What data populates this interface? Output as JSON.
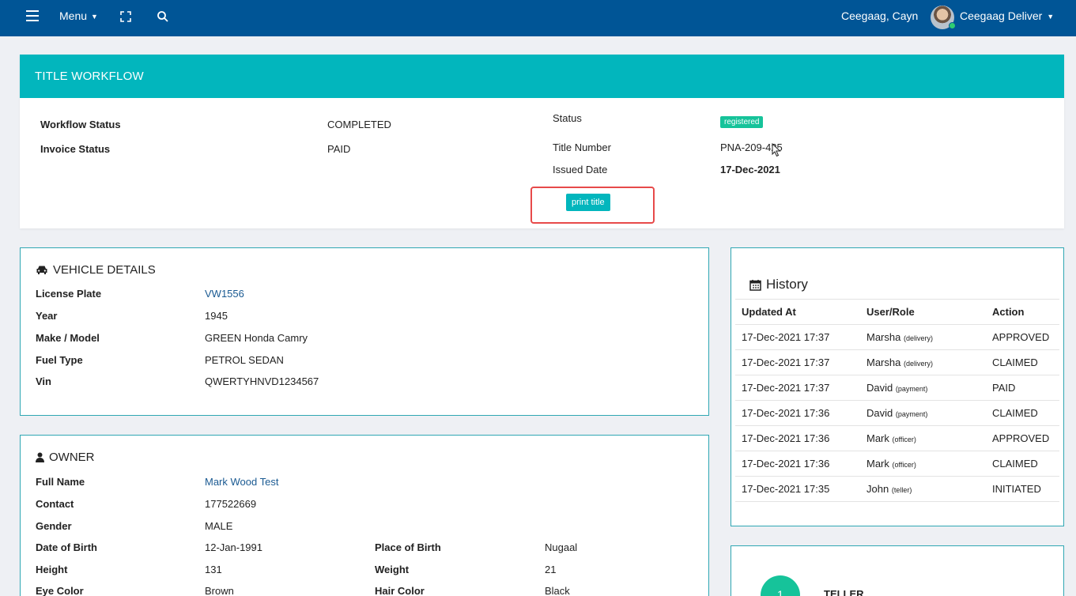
{
  "topbar": {
    "menu_label": "Menu",
    "user_name": "Ceegaag, Cayn",
    "user_role": "Ceegaag Deliver"
  },
  "workflow": {
    "header": "TITLE WORKFLOW",
    "workflow_status_label": "Workflow Status",
    "workflow_status_value": "COMPLETED",
    "invoice_status_label": "Invoice Status",
    "invoice_status_value": "PAID",
    "status_label": "Status",
    "status_badge": "registered",
    "title_number_label": "Title Number",
    "title_number_value": "PNA-209-425",
    "issued_date_label": "Issued Date",
    "issued_date_value": "17-Dec-2021",
    "print_button": "print title"
  },
  "vehicle": {
    "title": "VEHICLE DETAILS",
    "rows": [
      {
        "label": "License Plate",
        "value": "VW1556"
      },
      {
        "label": "Year",
        "value": "1945"
      },
      {
        "label": "Make / Model",
        "value": "GREEN Honda Camry"
      },
      {
        "label": "Fuel Type",
        "value": "PETROL SEDAN"
      },
      {
        "label": "Vin",
        "value": "QWERTYHNVD1234567"
      }
    ]
  },
  "owner": {
    "title": "OWNER",
    "full_name_label": "Full Name",
    "full_name": "Mark Wood Test",
    "contact_label": "Contact",
    "contact": "177522669",
    "gender_label": "Gender",
    "gender": "MALE",
    "dob_label": "Date of Birth",
    "dob": "12-Jan-1991",
    "pob_label": "Place of Birth",
    "pob": "Nugaal",
    "height_label": "Height",
    "height": "131",
    "weight_label": "Weight",
    "weight": "21",
    "eye_label": "Eye Color",
    "eye": "Brown",
    "hair_label": "Hair Color",
    "hair": "Black"
  },
  "history": {
    "title": "History",
    "headers": [
      "Updated At",
      "User/Role",
      "Action"
    ],
    "rows": [
      {
        "at": "17-Dec-2021 17:37",
        "user": "Marsha",
        "role": "(delivery)",
        "action": "APPROVED"
      },
      {
        "at": "17-Dec-2021 17:37",
        "user": "Marsha",
        "role": "(delivery)",
        "action": "CLAIMED"
      },
      {
        "at": "17-Dec-2021 17:37",
        "user": "David",
        "role": "(payment)",
        "action": "PAID"
      },
      {
        "at": "17-Dec-2021 17:36",
        "user": "David",
        "role": "(payment)",
        "action": "CLAIMED"
      },
      {
        "at": "17-Dec-2021 17:36",
        "user": "Mark",
        "role": "(officer)",
        "action": "APPROVED"
      },
      {
        "at": "17-Dec-2021 17:36",
        "user": "Mark",
        "role": "(officer)",
        "action": "CLAIMED"
      },
      {
        "at": "17-Dec-2021 17:35",
        "user": "John",
        "role": "(teller)",
        "action": "INITIATED"
      }
    ]
  },
  "teller": {
    "step": "1",
    "label": "TELLER"
  }
}
